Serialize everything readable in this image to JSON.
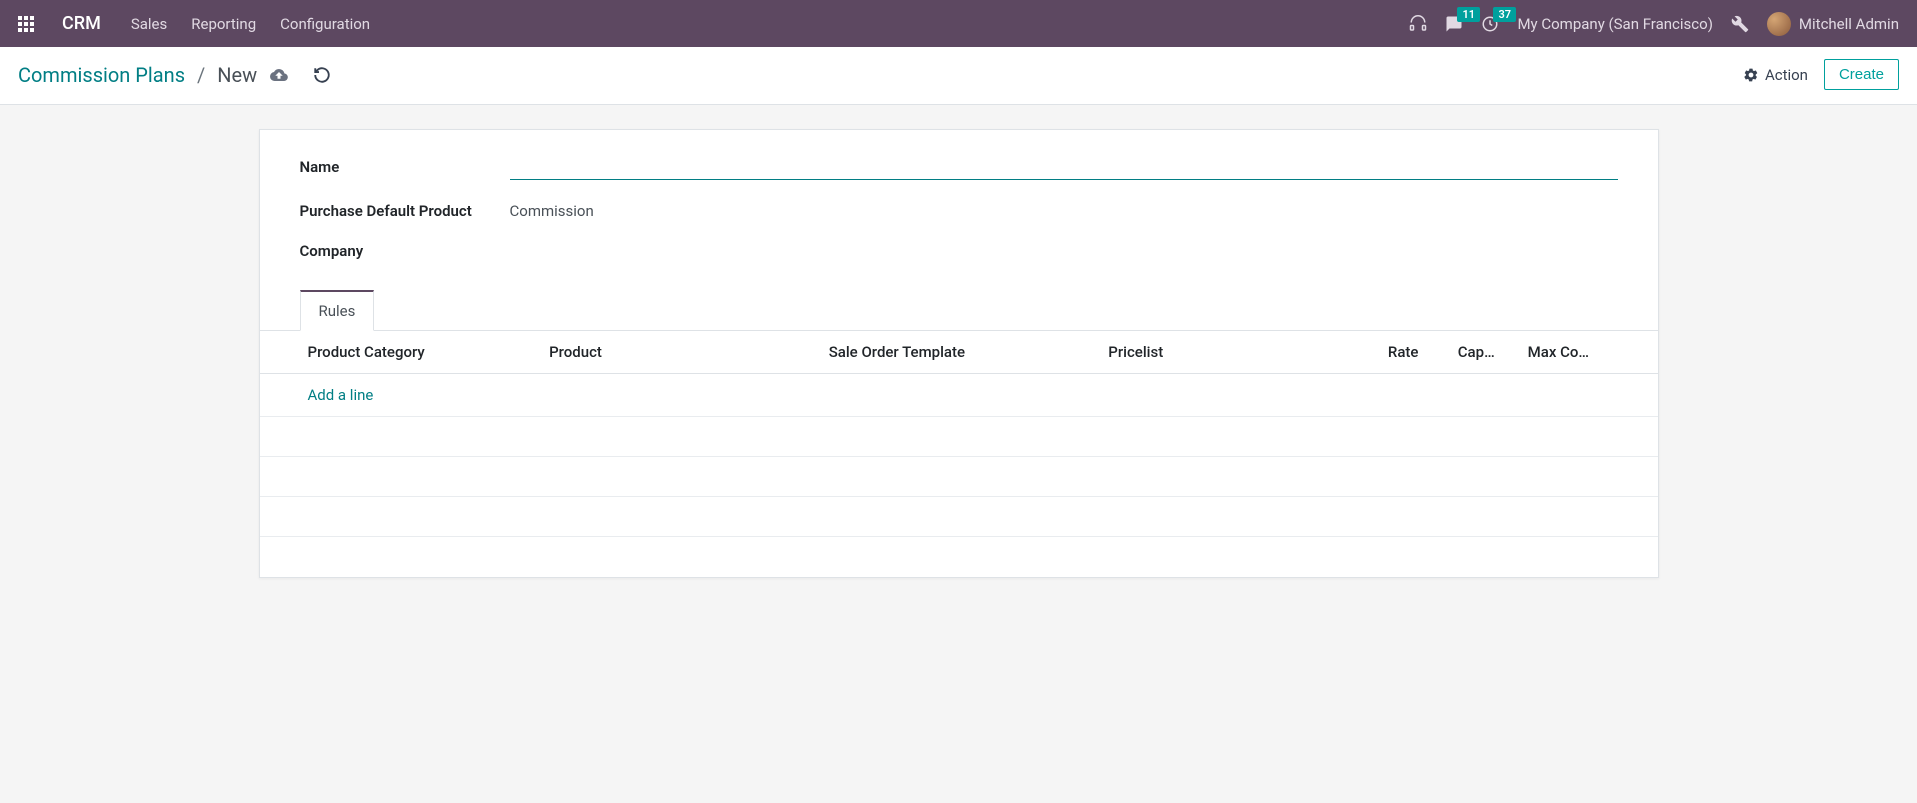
{
  "navbar": {
    "brand": "CRM",
    "menu": [
      "Sales",
      "Reporting",
      "Configuration"
    ],
    "messages_badge": "11",
    "activities_badge": "37",
    "company": "My Company (San Francisco)",
    "user": "Mitchell Admin"
  },
  "breadcrumb": {
    "parent": "Commission Plans",
    "current": "New"
  },
  "actions": {
    "action_label": "Action",
    "create_label": "Create"
  },
  "form": {
    "name_label": "Name",
    "name_value": "",
    "purchase_default_product_label": "Purchase Default Product",
    "purchase_default_product_value": "Commission",
    "company_label": "Company",
    "company_value": ""
  },
  "tabs": {
    "rules_label": "Rules"
  },
  "table": {
    "columns": {
      "product_category": "Product Category",
      "product": "Product",
      "sale_order_template": "Sale Order Template",
      "pricelist": "Pricelist",
      "rate": "Rate",
      "capped": "Cap…",
      "max_commission": "Max Co…"
    },
    "add_line": "Add a line"
  }
}
